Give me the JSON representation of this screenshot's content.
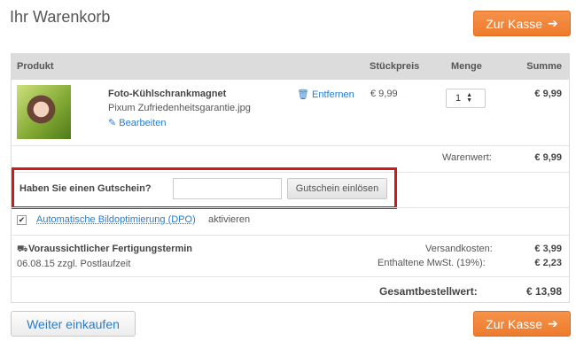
{
  "title": "Ihr Warenkorb",
  "checkout_label": "Zur Kasse",
  "columns": {
    "product": "Produkt",
    "unit_price": "Stückpreis",
    "quantity": "Menge",
    "total": "Summe"
  },
  "item": {
    "name": "Foto-Kühlschrankmagnet",
    "file": "Pixum Zufriedenheitsgarantie.jpg",
    "edit": "Bearbeiten",
    "remove": "Entfernen",
    "unit_price": "€ 9,99",
    "quantity": "1",
    "total": "€ 9,99"
  },
  "merchandise_value": {
    "label": "Warenwert:",
    "value": "€ 9,99"
  },
  "voucher": {
    "label": "Haben Sie einen Gutschein?",
    "input_value": "",
    "button": "Gutschein einlösen"
  },
  "dpo": {
    "link": "Automatische Bildoptimierung (DPO)",
    "text": "aktivieren",
    "checked": true
  },
  "production": {
    "title": "Voraussichtlicher Fertigungstermin",
    "date": "06.08.15 zzgl. Postlaufzeit"
  },
  "shipping": {
    "label": "Versandkosten:",
    "value": "€ 3,99"
  },
  "vat": {
    "label": "Enthaltene MwSt. (19%):",
    "value": "€ 2,23"
  },
  "grand_total": {
    "label": "Gesamtbestellwert:",
    "value": "€ 13,98"
  },
  "continue_label": "Weiter einkaufen",
  "colors": {
    "accent": "#f08535",
    "link": "#2a7cc7",
    "highlight": "#d0191f"
  }
}
